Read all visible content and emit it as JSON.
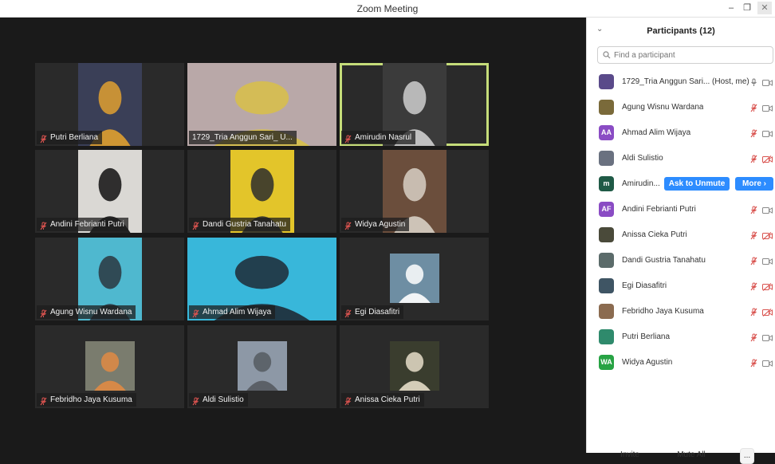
{
  "window": {
    "title": "Zoom Meeting",
    "minimize": "–",
    "restore": "❐",
    "close": "✕"
  },
  "tiles": [
    {
      "name": "Putri Berliana",
      "muted": true,
      "bg": "#2a2a2a",
      "video_bg": "#3a3f57",
      "accent": "#e0a030"
    },
    {
      "name": "1729_Tria Anggun Sari_ U...",
      "muted": false,
      "bg": "#2a2a2a",
      "video_bg": "#b9a8a8",
      "accent": "#d8c048"
    },
    {
      "name": "Amirudin Nasrul",
      "muted": true,
      "active": true,
      "bg": "#2a2a2a",
      "video_bg": "#3b3b3b",
      "accent": "#cfcfcf"
    },
    {
      "name": "Andini Febrianti Putri",
      "muted": true,
      "bg": "#2a2a2a",
      "video_bg": "#dad8d4",
      "accent": "#111111"
    },
    {
      "name": "Dandi Gustria Tanahatu",
      "muted": true,
      "bg": "#2a2a2a",
      "video_bg": "#e3c52a",
      "accent": "#2d2d2d"
    },
    {
      "name": "Widya Agustin",
      "muted": true,
      "bg": "#2a2a2a",
      "video_bg": "#6b4e3c",
      "accent": "#d8d0c4"
    },
    {
      "name": "Agung Wisnu Wardana",
      "muted": true,
      "bg": "#2a2a2a",
      "video_bg": "#4fb8cf",
      "accent": "#2a3640"
    },
    {
      "name": "Ahmad Alim Wijaya",
      "muted": true,
      "bg": "#2a2a2a",
      "video_bg": "#38b7da",
      "accent": "#1e2a35"
    },
    {
      "name": "Egi Diasafitri",
      "muted": true,
      "bg": "#2a2a2a",
      "video_bg": "#6e8ea3",
      "accent": "#ffffff"
    },
    {
      "name": "Febridho Jaya Kusuma",
      "muted": true,
      "bg": "#2a2a2a",
      "video_bg": "#7a7c6e",
      "accent": "#e08b44"
    },
    {
      "name": "Aldi Sulistio",
      "muted": true,
      "bg": "#2a2a2a",
      "video_bg": "#8d98a6",
      "accent": "#555a60"
    },
    {
      "name": "Anissa Cieka Putri",
      "muted": true,
      "bg": "#2a2a2a",
      "video_bg": "#3a3d2e",
      "accent": "#e6ddc8"
    }
  ],
  "panel": {
    "title": "Participants (12)",
    "collapse_icon": "chevron-down-icon",
    "search_placeholder": "Find a participant",
    "participants": [
      {
        "name": "1729_Tria Anggun Sari... (Host, me)",
        "avatar_text": "",
        "avatar_color": "#5a4a8a",
        "mic": "on",
        "video": "off"
      },
      {
        "name": "Agung Wisnu Wardana",
        "avatar_text": "",
        "avatar_color": "#7a6a3a",
        "mic": "muted",
        "video": "off"
      },
      {
        "name": "Ahmad Alim Wijaya",
        "avatar_text": "AA",
        "avatar_color": "#8a4cc4",
        "mic": "muted",
        "video": "off"
      },
      {
        "name": "Aldi Sulistio",
        "avatar_text": "",
        "avatar_color": "#6a7180",
        "mic": "muted",
        "video": "stopped"
      },
      {
        "name": "Amirudin...",
        "avatar_text": "m",
        "avatar_color": "#1f5a46",
        "mic": "",
        "video": "",
        "hover": true,
        "ask_label": "Ask to Unmute",
        "more_label": "More ›"
      },
      {
        "name": "Andini Febrianti Putri",
        "avatar_text": "AF",
        "avatar_color": "#8a4cc4",
        "mic": "muted",
        "video": "off"
      },
      {
        "name": "Anissa Cieka Putri",
        "avatar_text": "",
        "avatar_color": "#4a4a3a",
        "mic": "muted",
        "video": "stopped"
      },
      {
        "name": "Dandi Gustria Tanahatu",
        "avatar_text": "",
        "avatar_color": "#5b6b6a",
        "mic": "muted",
        "video": "off"
      },
      {
        "name": "Egi Diasafitri",
        "avatar_text": "",
        "avatar_color": "#3f5564",
        "mic": "muted",
        "video": "stopped"
      },
      {
        "name": "Febridho Jaya Kusuma",
        "avatar_text": "",
        "avatar_color": "#8b6b50",
        "mic": "muted",
        "video": "stopped"
      },
      {
        "name": "Putri Berliana",
        "avatar_text": "",
        "avatar_color": "#2f8a6c",
        "mic": "muted",
        "video": "off"
      },
      {
        "name": "Widya Agustin",
        "avatar_text": "WA",
        "avatar_color": "#27a344",
        "mic": "muted",
        "video": "off"
      }
    ],
    "footer": {
      "invite": "Invite",
      "mute_all": "Mute All",
      "more": "..."
    }
  },
  "colors": {
    "accent_blue": "#2d8cff",
    "muted_red": "#d9534f",
    "active_border": "#c5dc79"
  }
}
